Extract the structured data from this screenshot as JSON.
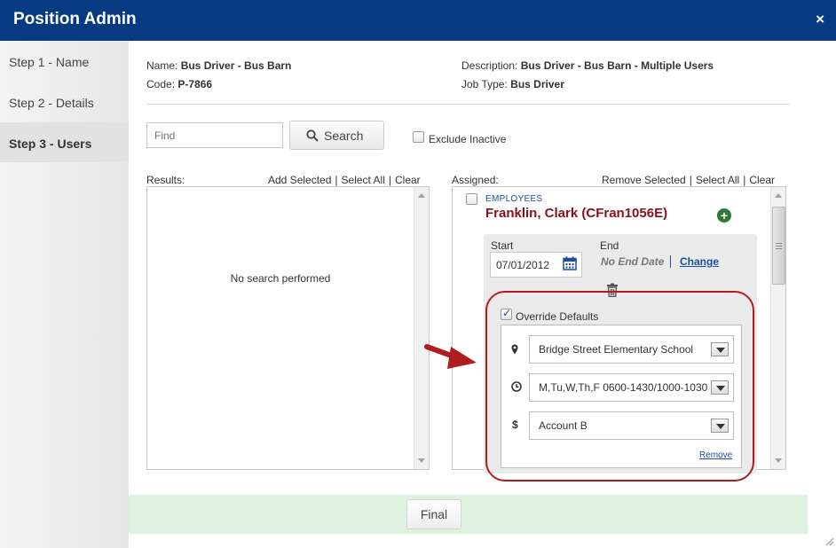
{
  "window": {
    "title": "Position Admin",
    "close_icon": "×"
  },
  "steps": [
    {
      "label": "Step 1 - Name"
    },
    {
      "label": "Step 2 - Details"
    },
    {
      "label": "Step 3 - Users"
    }
  ],
  "info": {
    "name_label": "Name:",
    "name_value": "Bus Driver - Bus Barn",
    "code_label": "Code:",
    "code_value": "P-7866",
    "description_label": "Description:",
    "description_value": "Bus Driver - Bus Barn - Multiple Users",
    "jobtype_label": "Job Type:",
    "jobtype_value": "Bus Driver"
  },
  "search": {
    "placeholder": "Find",
    "button_label": "Search",
    "exclude_label": "Exclude Inactive"
  },
  "results": {
    "header": "Results:",
    "add_selected": "Add Selected",
    "select_all": "Select All",
    "clear": "Clear",
    "empty_text": "No search performed"
  },
  "assigned": {
    "header": "Assigned:",
    "remove_selected": "Remove Selected",
    "select_all": "Select All",
    "clear": "Clear",
    "category": "EMPLOYEES",
    "employee_name": "Franklin, Clark (CFran1056E)",
    "start_label": "Start",
    "start_value": "07/01/2012",
    "end_label": "End",
    "end_value": "No End Date",
    "change_label": "Change",
    "override_label": "Override Defaults",
    "location_icon": "📍",
    "location_value": "Bridge Street Elementary School",
    "schedule_icon": "⊙",
    "schedule_value": "M,Tu,W,Th,F 0600-1430/1000-1030",
    "account_icon": "$",
    "account_value": "Account B",
    "remove_label": "Remove"
  },
  "footer": {
    "final_label": "Final"
  },
  "colors": {
    "titlebar": "#063b83",
    "name_red": "#8b0f1b",
    "link_blue": "#1b4fa0",
    "annotation_red": "#b01d20",
    "footer_green": "#dff1df"
  }
}
